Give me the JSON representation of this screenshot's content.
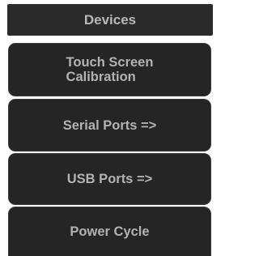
{
  "header": {
    "title": "Devices"
  },
  "menu": {
    "items": [
      {
        "label": "Touch Screen\nCalibration"
      },
      {
        "label": "Serial Ports =>"
      },
      {
        "label": "USB Ports =>"
      },
      {
        "label": "Power Cycle"
      }
    ]
  },
  "colors": {
    "panel_background": "#252525",
    "button_border": "#3a3a3a",
    "text": "#b3b3b3"
  }
}
